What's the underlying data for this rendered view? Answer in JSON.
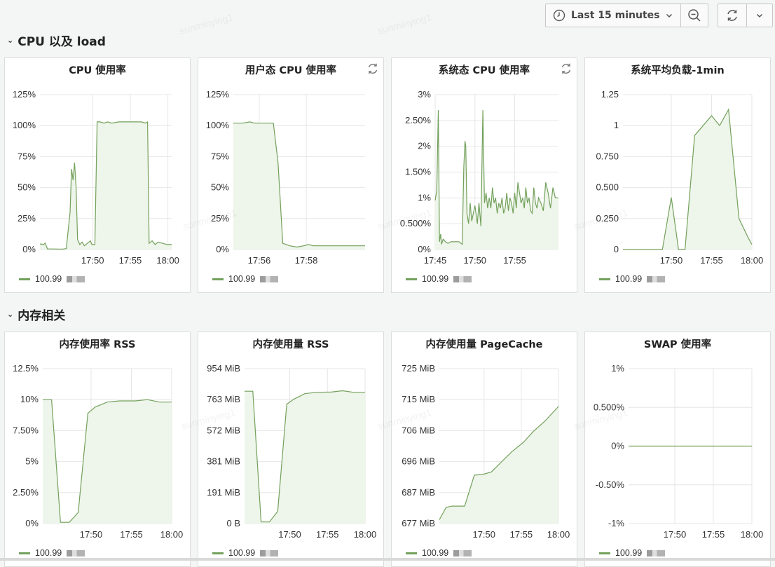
{
  "toolbar": {
    "time_range": "Last 15 minutes",
    "icons": [
      "clock-icon",
      "chevron-down-icon",
      "zoom-out-icon",
      "refresh-icon",
      "chevron-down-icon"
    ]
  },
  "watermark_text": "sunminying1",
  "colors": {
    "series": "#73a15c",
    "fill": "#eef5ea",
    "grid": "#e6e6e6"
  },
  "rows": [
    {
      "title": "CPU 以及 load"
    },
    {
      "title": "内存相关"
    }
  ],
  "panels": [
    {
      "title": "CPU 使用率",
      "has_refresh": false,
      "legend": "100.99",
      "chart_data": {
        "type": "area",
        "x_unit": "time",
        "yticks": [
          "0%",
          "25%",
          "50%",
          "75%",
          "100%",
          "125%"
        ],
        "ylim": [
          0,
          125
        ],
        "xticks": [
          {
            "label": "17:50",
            "v": 17.5
          },
          {
            "label": "17:55",
            "v": 22.5
          },
          {
            "label": "18:00",
            "v": 27.5
          }
        ],
        "xlim": [
          10.5,
          28.0
        ],
        "points": [
          [
            10.5,
            4.5
          ],
          [
            11.0,
            4.0
          ],
          [
            11.2,
            5.2
          ],
          [
            11.5,
            0.5
          ],
          [
            13.5,
            0.3
          ],
          [
            14.0,
            0.8
          ],
          [
            14.5,
            30
          ],
          [
            14.7,
            65
          ],
          [
            14.9,
            56
          ],
          [
            15.1,
            70
          ],
          [
            15.3,
            50
          ],
          [
            15.5,
            8
          ],
          [
            15.8,
            4
          ],
          [
            16.1,
            6
          ],
          [
            16.4,
            3
          ],
          [
            16.8,
            5
          ],
          [
            17.2,
            7
          ],
          [
            17.4,
            4
          ],
          [
            17.8,
            4
          ],
          [
            18.1,
            103
          ],
          [
            18.5,
            103
          ],
          [
            19,
            102
          ],
          [
            19.5,
            103
          ],
          [
            20,
            102
          ],
          [
            21,
            103
          ],
          [
            22,
            103
          ],
          [
            23,
            103
          ],
          [
            24,
            103
          ],
          [
            24.5,
            102
          ],
          [
            24.8,
            103
          ],
          [
            25.0,
            5
          ],
          [
            25.4,
            7
          ],
          [
            25.8,
            4
          ],
          [
            26.2,
            6
          ],
          [
            26.8,
            5
          ],
          [
            27.4,
            4
          ],
          [
            28.0,
            4
          ]
        ]
      }
    },
    {
      "title": "用户态 CPU 使用率",
      "has_refresh": true,
      "legend": "100.99",
      "chart_data": {
        "type": "area",
        "x_unit": "time",
        "yticks": [
          "0%",
          "25%",
          "50%",
          "75%",
          "100%",
          "125%"
        ],
        "ylim": [
          0,
          125
        ],
        "xticks": [
          {
            "label": "17:56",
            "v": 56
          },
          {
            "label": "17:58",
            "v": 58
          }
        ],
        "xlim": [
          54.9,
          60.5
        ],
        "points": [
          [
            54.9,
            102
          ],
          [
            55.3,
            102
          ],
          [
            55.6,
            103
          ],
          [
            55.8,
            102
          ],
          [
            56.4,
            102
          ],
          [
            56.6,
            102
          ],
          [
            56.8,
            70
          ],
          [
            57.0,
            5
          ],
          [
            57.3,
            3
          ],
          [
            57.6,
            2
          ],
          [
            57.9,
            3
          ],
          [
            58.1,
            4
          ],
          [
            58.3,
            3
          ],
          [
            58.6,
            3
          ],
          [
            59.1,
            3
          ],
          [
            59.6,
            3
          ],
          [
            60.5,
            3
          ]
        ]
      }
    },
    {
      "title": "系统态 CPU 使用率",
      "has_refresh": true,
      "legend": "100.99",
      "chart_data": {
        "type": "area",
        "x_unit": "time",
        "yticks": [
          "0%",
          "0.500%",
          "1%",
          "1.50%",
          "2%",
          "2.50%",
          "3%"
        ],
        "ylim": [
          0,
          3
        ],
        "xticks": [
          {
            "label": "17:45",
            "v": 45
          },
          {
            "label": "17:50",
            "v": 50
          },
          {
            "label": "17:55",
            "v": 55
          }
        ],
        "xlim": [
          45,
          60.5
        ],
        "points": [
          [
            45,
            0.95
          ],
          [
            45.2,
            1.15
          ],
          [
            45.4,
            2.7
          ],
          [
            45.55,
            0.15
          ],
          [
            45.7,
            0.3
          ],
          [
            45.8,
            0.1
          ],
          [
            46,
            0.2
          ],
          [
            46.3,
            0.15
          ],
          [
            46.6,
            0.12
          ],
          [
            47,
            0.15
          ],
          [
            47.5,
            0.15
          ],
          [
            48,
            0.15
          ],
          [
            48.4,
            0.1
          ],
          [
            48.6,
            1.6
          ],
          [
            48.75,
            2.1
          ],
          [
            48.85,
            2.0
          ],
          [
            49,
            0.7
          ],
          [
            49.2,
            0.5
          ],
          [
            49.4,
            0.9
          ],
          [
            49.6,
            0.55
          ],
          [
            49.8,
            0.7
          ],
          [
            50,
            0.85
          ],
          [
            50.3,
            0.5
          ],
          [
            50.5,
            0.9
          ],
          [
            50.75,
            0.45
          ],
          [
            51,
            2.7
          ],
          [
            51.2,
            0.9
          ],
          [
            51.4,
            1.1
          ],
          [
            51.6,
            0.8
          ],
          [
            51.8,
            1.0
          ],
          [
            52,
            0.8
          ],
          [
            52.2,
            1.2
          ],
          [
            52.4,
            0.9
          ],
          [
            52.6,
            1.0
          ],
          [
            52.8,
            0.7
          ],
          [
            53,
            0.9
          ],
          [
            53.2,
            0.8
          ],
          [
            53.4,
            1.0
          ],
          [
            53.6,
            0.7
          ],
          [
            53.8,
            0.8
          ],
          [
            54,
            1.1
          ],
          [
            54.2,
            0.75
          ],
          [
            54.4,
            1.0
          ],
          [
            54.6,
            0.9
          ],
          [
            54.8,
            0.7
          ],
          [
            55,
            1.1
          ],
          [
            55.2,
            0.8
          ],
          [
            55.4,
            1.3
          ],
          [
            55.6,
            1.1
          ],
          [
            55.8,
            0.9
          ],
          [
            56,
            1.0
          ],
          [
            56.2,
            0.8
          ],
          [
            56.4,
            1.2
          ],
          [
            56.6,
            0.9
          ],
          [
            56.8,
            1.0
          ],
          [
            57,
            0.75
          ],
          [
            57.2,
            0.7
          ],
          [
            57.4,
            1.2
          ],
          [
            57.6,
            0.9
          ],
          [
            57.8,
            0.8
          ],
          [
            58.0,
            1.0
          ],
          [
            58.3,
            0.9
          ],
          [
            58.6,
            0.75
          ],
          [
            58.9,
            1.3
          ],
          [
            59.2,
            1.1
          ],
          [
            59.5,
            0.8
          ],
          [
            59.8,
            1.2
          ],
          [
            60.1,
            1.0
          ],
          [
            60.5,
            1.0
          ]
        ]
      }
    },
    {
      "title": "系统平均负载-1min",
      "has_refresh": false,
      "legend": "100.99",
      "chart_data": {
        "type": "area",
        "x_unit": "time",
        "yticks": [
          "0",
          "0.250",
          "0.500",
          "0.750",
          "1",
          "1.25"
        ],
        "ylim": [
          0,
          1.25
        ],
        "xticks": [
          {
            "label": "17:50",
            "v": 17.5
          },
          {
            "label": "17:55",
            "v": 22.5
          },
          {
            "label": "18:00",
            "v": 27.5
          }
        ],
        "xlim": [
          11.5,
          27.5
        ],
        "points": [
          [
            11.5,
            0
          ],
          [
            16.4,
            0
          ],
          [
            17.5,
            0.42
          ],
          [
            18.4,
            0
          ],
          [
            19.2,
            0
          ],
          [
            20.4,
            0.92
          ],
          [
            22.5,
            1.08
          ],
          [
            23.5,
            1.0
          ],
          [
            24.6,
            1.13
          ],
          [
            25.9,
            0.25
          ],
          [
            27.0,
            0.1
          ],
          [
            27.5,
            0.04
          ]
        ]
      }
    },
    {
      "title": "内存使用率 RSS",
      "has_refresh": false,
      "legend": "100.99",
      "chart_data": {
        "type": "area",
        "x_unit": "time",
        "yticks": [
          "0%",
          "2.50%",
          "5%",
          "7.50%",
          "10%",
          "12.5%"
        ],
        "ylim": [
          0,
          12.5
        ],
        "xticks": [
          {
            "label": "17:50",
            "v": 17.5
          },
          {
            "label": "17:55",
            "v": 22.5
          },
          {
            "label": "18:00",
            "v": 27.5
          }
        ],
        "xlim": [
          11.5,
          27.5
        ],
        "points": [
          [
            11.5,
            10
          ],
          [
            12.6,
            10
          ],
          [
            13.7,
            0.1
          ],
          [
            14.8,
            0.1
          ],
          [
            15.9,
            0.9
          ],
          [
            17.1,
            8.9
          ],
          [
            18.0,
            9.4
          ],
          [
            19.5,
            9.8
          ],
          [
            21.0,
            9.9
          ],
          [
            23.0,
            9.9
          ],
          [
            24.5,
            10.0
          ],
          [
            26.0,
            9.8
          ],
          [
            27.5,
            9.8
          ]
        ]
      }
    },
    {
      "title": "内存使用量 RSS",
      "has_refresh": false,
      "legend": "100.99",
      "chart_data": {
        "type": "area",
        "x_unit": "time",
        "yticks": [
          "0 B",
          "191 MiB",
          "381 MiB",
          "572 MiB",
          "763 MiB",
          "954 MiB"
        ],
        "ylim": [
          0,
          954
        ],
        "xticks": [
          {
            "label": "17:50",
            "v": 17.5
          },
          {
            "label": "17:55",
            "v": 22.5
          },
          {
            "label": "18:00",
            "v": 27.5
          }
        ],
        "xlim": [
          11.5,
          27.5
        ],
        "points": [
          [
            11.5,
            815
          ],
          [
            12.6,
            815
          ],
          [
            13.7,
            10
          ],
          [
            14.8,
            10
          ],
          [
            15.9,
            75
          ],
          [
            17.1,
            735
          ],
          [
            18.0,
            765
          ],
          [
            19.5,
            800
          ],
          [
            21.0,
            808
          ],
          [
            23.0,
            810
          ],
          [
            24.5,
            818
          ],
          [
            26.0,
            808
          ],
          [
            27.5,
            808
          ]
        ]
      }
    },
    {
      "title": "内存使用量 PageCache",
      "has_refresh": false,
      "legend": "100.99",
      "chart_data": {
        "type": "area",
        "x_unit": "time",
        "yticks": [
          "677 MiB",
          "687 MiB",
          "696 MiB",
          "706 MiB",
          "715 MiB",
          "725 MiB"
        ],
        "ylim": [
          677,
          725
        ],
        "xticks": [
          {
            "label": "17:50",
            "v": 17.5
          },
          {
            "label": "17:55",
            "v": 22.5
          },
          {
            "label": "18:00",
            "v": 27.5
          }
        ],
        "xlim": [
          11.5,
          27.5
        ],
        "points": [
          [
            11.5,
            678.2
          ],
          [
            12.4,
            682.0
          ],
          [
            13.2,
            682.4
          ],
          [
            14.2,
            682.4
          ],
          [
            14.9,
            682.4
          ],
          [
            16.2,
            692.0
          ],
          [
            17.3,
            692.2
          ],
          [
            18.5,
            693.0
          ],
          [
            19.8,
            696.0
          ],
          [
            21.2,
            699.2
          ],
          [
            22.8,
            702.2
          ],
          [
            24.1,
            705.5
          ],
          [
            25.7,
            708.8
          ],
          [
            27.5,
            713.3
          ]
        ]
      }
    },
    {
      "title": "SWAP 使用率",
      "has_refresh": false,
      "legend": "100.99",
      "chart_data": {
        "type": "line",
        "x_unit": "time",
        "yticks": [
          "-1%",
          "-0.50%",
          "0%",
          "0.500%",
          "1%"
        ],
        "ylim": [
          -1,
          1
        ],
        "xticks": [
          {
            "label": "17:50",
            "v": 17.5
          },
          {
            "label": "17:55",
            "v": 22.5
          },
          {
            "label": "18:00",
            "v": 27.5
          }
        ],
        "xlim": [
          11.5,
          27.5
        ],
        "points": [
          [
            11.5,
            0
          ],
          [
            27.5,
            0
          ]
        ]
      }
    }
  ]
}
